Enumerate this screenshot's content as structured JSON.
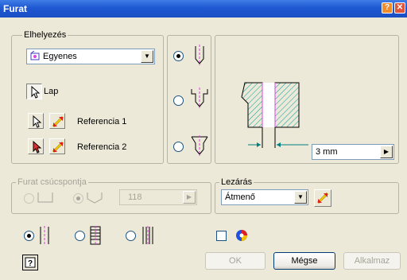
{
  "window": {
    "title": "Furat"
  },
  "placement": {
    "group_label": "Elhelyezés",
    "type_value": "Egyenes",
    "face_label": "Lap",
    "ref1_label": "Referencia 1",
    "ref2_label": "Referencia 2"
  },
  "preview": {
    "dimension_value": "3 mm"
  },
  "drill_point": {
    "group_label": "Furat csúcspontja",
    "angle_value": "118"
  },
  "termination": {
    "group_label": "Lezárás",
    "value": "Átmenő"
  },
  "buttons": {
    "ok": "OK",
    "cancel": "Mégse",
    "apply": "Alkalmaz"
  },
  "colors": {
    "titlebar": "#1e58d2",
    "hatch": "#00a0a0",
    "hole_line": "#e040e0",
    "dimension": "#008080"
  }
}
